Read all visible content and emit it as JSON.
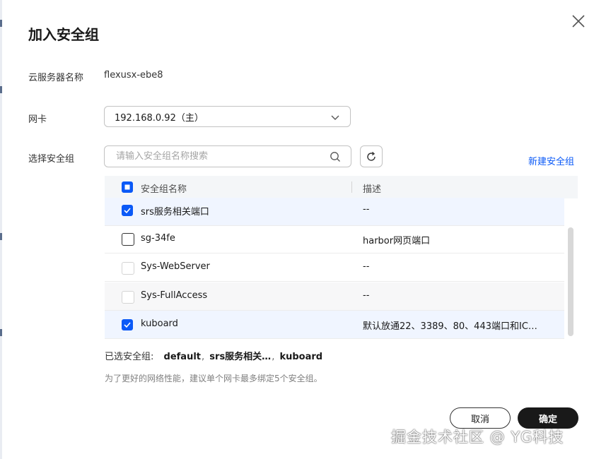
{
  "dialog": {
    "title": "加入安全组"
  },
  "server": {
    "label": "云服务器名称",
    "value": "flexusx-ebe8"
  },
  "nic": {
    "label": "网卡",
    "selected": "192.168.0.92（主）"
  },
  "security_group": {
    "label": "选择安全组",
    "search_placeholder": "请输入安全组名称搜索",
    "new_link": "新建安全组"
  },
  "table": {
    "columns": [
      "安全组名称",
      "描述"
    ],
    "rows": [
      {
        "name": "srs服务相关端口",
        "desc": "--",
        "checked": true,
        "state": "selected"
      },
      {
        "name": "sg-34fe",
        "desc": "harbor网页端口",
        "checked": false,
        "state": "normal"
      },
      {
        "name": "Sys-WebServer",
        "desc": "--",
        "checked": false,
        "state": "disabled"
      },
      {
        "name": "Sys-FullAccess",
        "desc": "--",
        "checked": false,
        "state": "disabled"
      },
      {
        "name": "kuboard",
        "desc": "默认放通22、3389、80、443端口和IC…",
        "checked": true,
        "state": "selected"
      }
    ]
  },
  "selected": {
    "label": "已选安全组:",
    "tags": [
      "default",
      "srs服务相关…",
      "kuboard"
    ]
  },
  "hint": "为了更好的网络性能，建议单个网卡最多绑定5个安全组。",
  "buttons": {
    "cancel": "取消",
    "ok": "确定"
  },
  "watermark": "掘金技术社区 @ YG科技",
  "colors": {
    "accent": "#0a59f7",
    "primary_button": "#191919"
  }
}
